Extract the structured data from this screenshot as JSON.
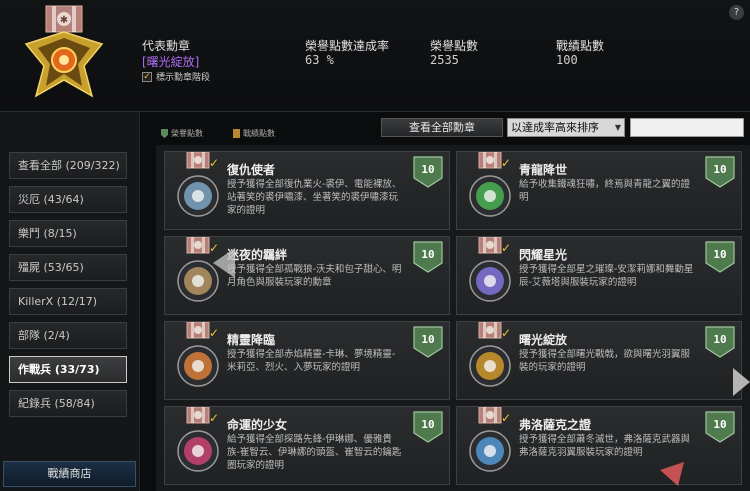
{
  "header": {
    "rep_label": "代表勳章",
    "rep_name": "[曙光綻放]",
    "show_level_label": "標示勳章階段",
    "show_level_checked": true,
    "rate_label": "榮譽點數達成率",
    "rate_value": "63 %",
    "honor_label": "榮譽點數",
    "honor_value": "2535",
    "battle_label": "戰績點數",
    "battle_value": "100",
    "help_glyph": "?"
  },
  "sidebar": {
    "items": [
      {
        "label": "查看全部 (209/322)"
      },
      {
        "label": "災厄 (43/64)"
      },
      {
        "label": "樂鬥 (8/15)"
      },
      {
        "label": "殭屍 (53/65)"
      },
      {
        "label": "KillerX (12/17)"
      },
      {
        "label": "部隊 (2/4)"
      },
      {
        "label": "作戰兵 (33/73)"
      },
      {
        "label": "紀錄兵 (58/84)"
      }
    ],
    "active_index": 6,
    "shop_label": "戰績商店"
  },
  "toolbar": {
    "legend_honor": "榮譽點數",
    "legend_battle": "戰績點數",
    "view_all_label": "查看全部勳章",
    "sort_value": "以達成率高來排序",
    "search_value": ""
  },
  "cards": [
    {
      "title": "復仇使者",
      "desc": "授予獲得全部復仇業火-裘伊、電能裸放、站著笑的裘伊嘯漆、坐著笑的裘伊嘯漆玩家的證明",
      "points": "10",
      "accent": "#8ab6d6"
    },
    {
      "title": "青龍降世",
      "desc": "給予收集鐵魂狂嘯，終焉與青龍之翼的證明",
      "points": "10",
      "accent": "#4fc35a"
    },
    {
      "title": "迷夜的羈絆",
      "desc": "授予獲得全部孤戰狼-沃夫和包子甜心、明月角色與服裝玩家的勳章",
      "points": "10",
      "accent": "#c9a46a"
    },
    {
      "title": "閃耀星光",
      "desc": "授予獲得全部星之璀璨-安潔莉娜和舞動星辰-艾薇塔與服裝玩家的證明",
      "points": "10",
      "accent": "#8f7cf0"
    },
    {
      "title": "精靈降臨",
      "desc": "授予獲得全部赤焰精靈-卡琳、夢境精靈-米莉亞、烈火、入夢玩家的證明",
      "points": "10",
      "accent": "#f08a3a"
    },
    {
      "title": "曙光綻放",
      "desc": "授予獲得全部曙光戰戟，欲與曙光羽翼服裝的玩家的證明",
      "points": "10",
      "accent": "#e6a52a"
    },
    {
      "title": "命運的少女",
      "desc": "給予獲得全部探路先鋒-伊琳娜、優雅貴族-崔智云、伊琳娜的頭盔、崔智云的鑰匙圈玩家的證明",
      "points": "10",
      "accent": "#e0467a"
    },
    {
      "title": "弗洛薩克之證",
      "desc": "授予獲得全部蕭冬滅世，弗洛薩克武器與弗洛薩克羽翼服裝玩家的證明",
      "points": "10",
      "accent": "#5aa6e8"
    }
  ],
  "colors": {
    "rep_name": "#b06cf0",
    "honor_badge": "#4e7a4e",
    "check_mark": "#f1c232",
    "legend_honor": "#5c8a5c",
    "legend_battle": "#b8892f"
  }
}
